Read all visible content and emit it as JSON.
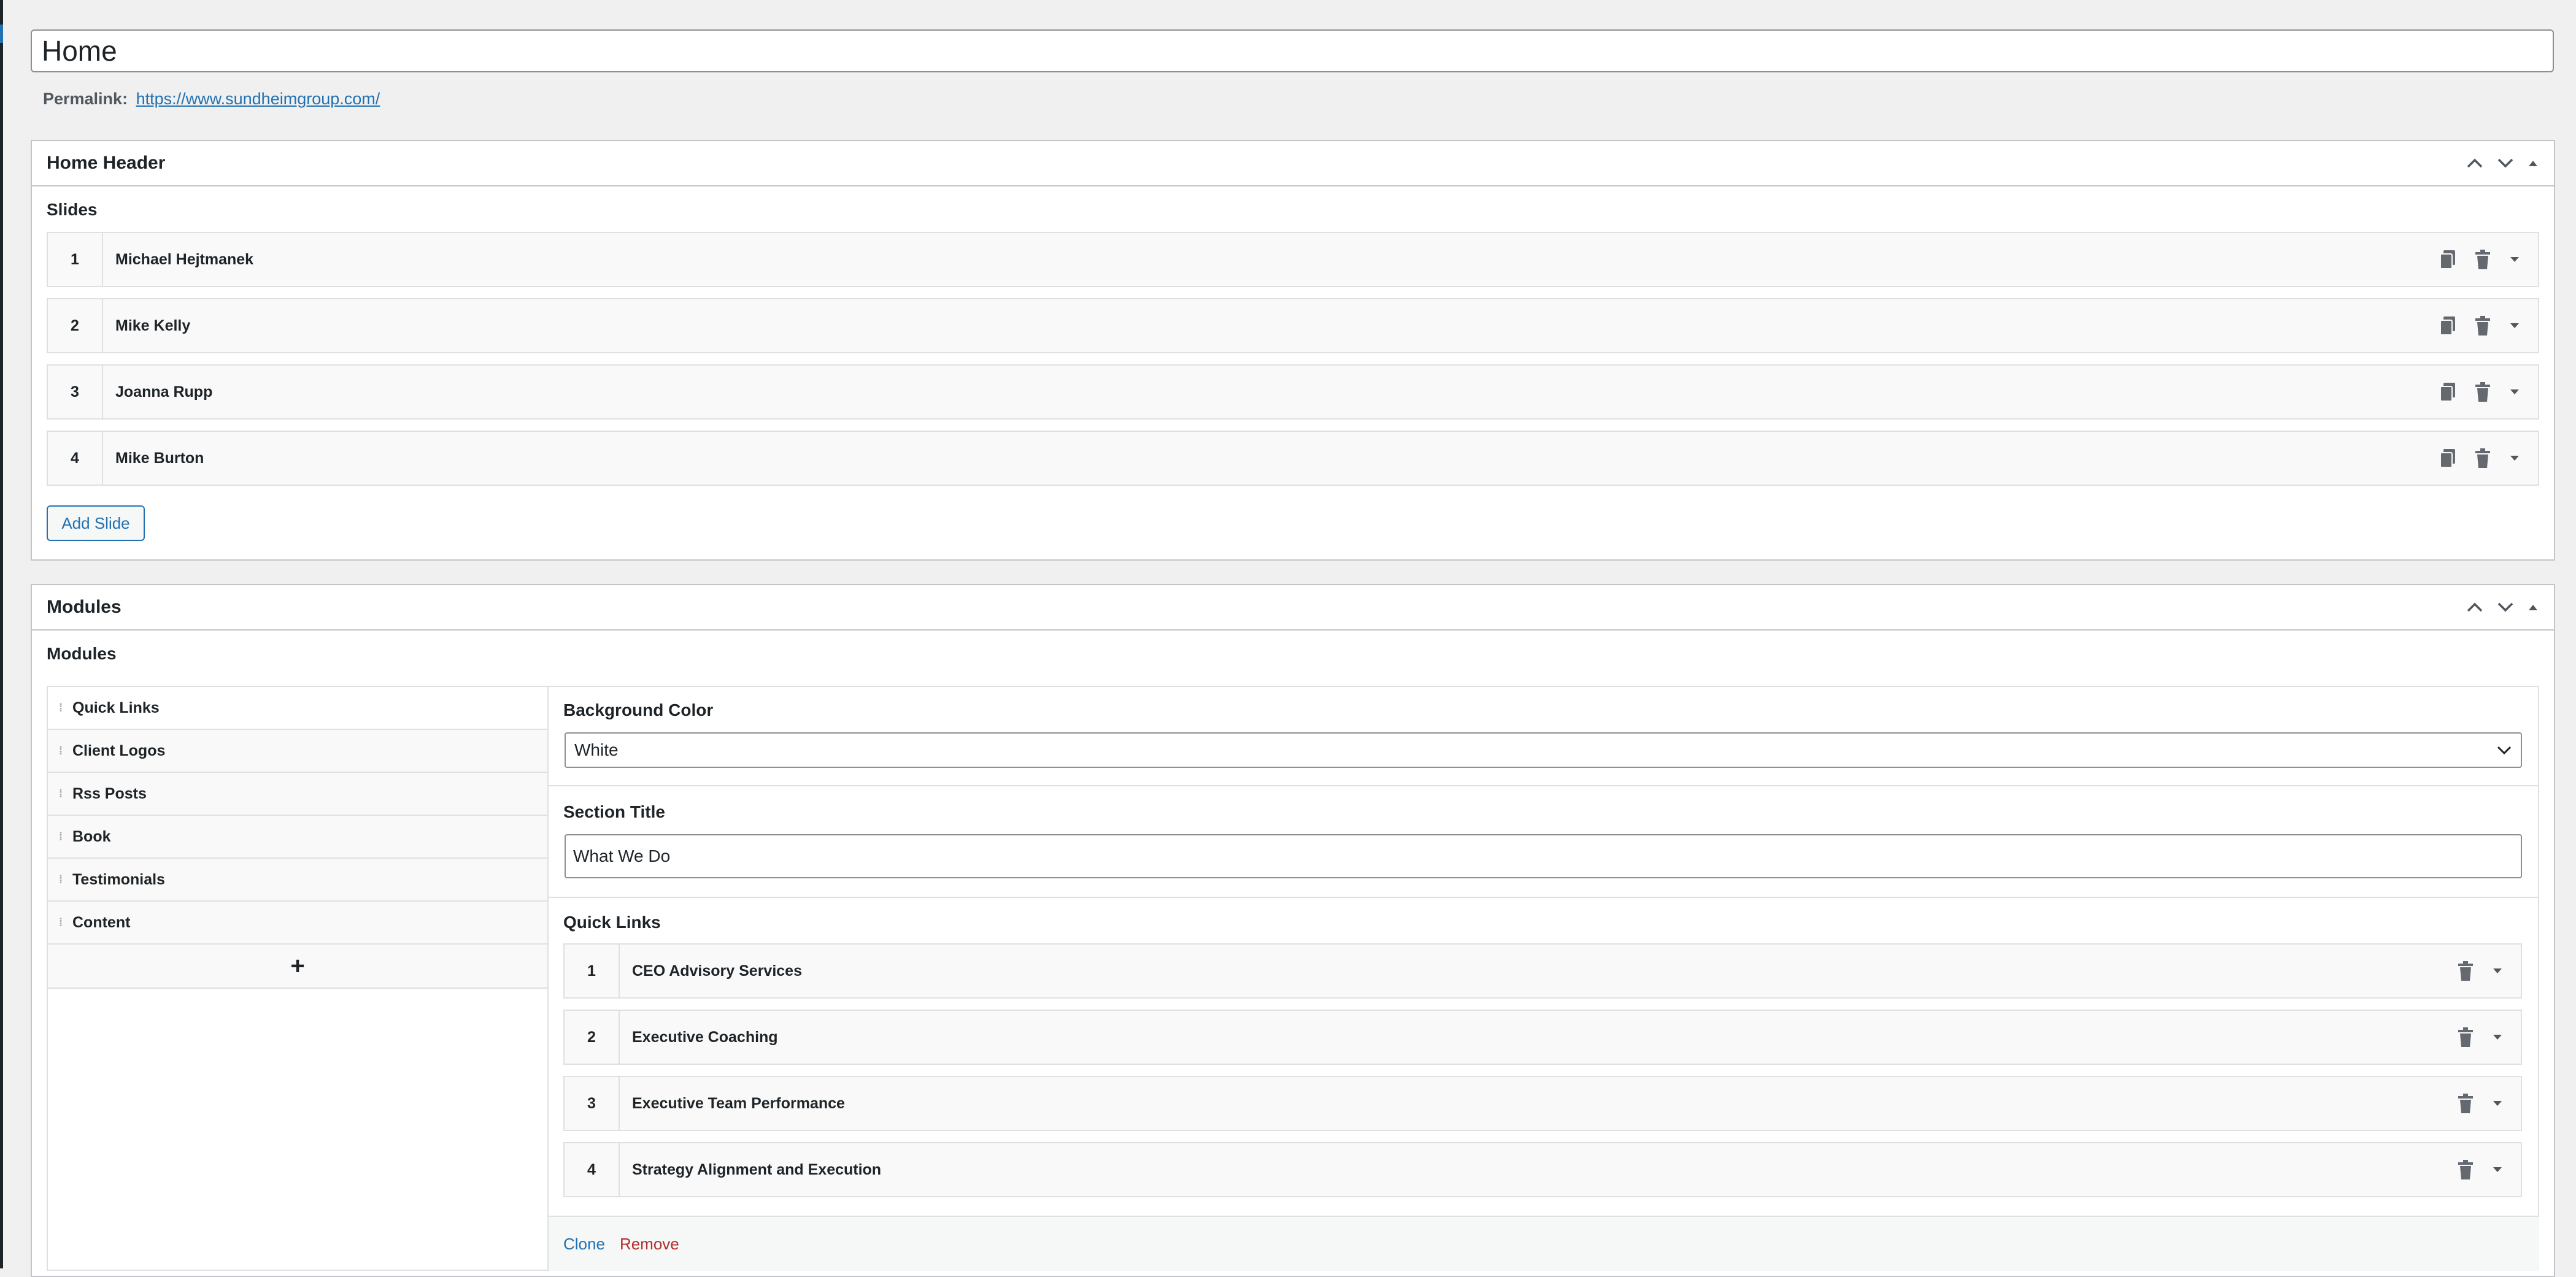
{
  "title": "Home",
  "permalink": {
    "label": "Permalink:",
    "url": "https://www.sundheimgroup.com/"
  },
  "home_header": {
    "title": "Home Header",
    "field_label": "Slides",
    "slides": [
      {
        "num": "1",
        "name": "Michael Hejtmanek"
      },
      {
        "num": "2",
        "name": "Mike Kelly"
      },
      {
        "num": "3",
        "name": "Joanna Rupp"
      },
      {
        "num": "4",
        "name": "Mike Burton"
      }
    ],
    "add_button": "Add Slide"
  },
  "modules": {
    "title": "Modules",
    "field_label": "Modules",
    "layouts": [
      "Quick Links",
      "Client Logos",
      "Rss Posts",
      "Book",
      "Testimonials",
      "Content"
    ],
    "add_symbol": "+",
    "background_color": {
      "label": "Background Color",
      "value": "White"
    },
    "section_title": {
      "label": "Section Title",
      "value": "What We Do"
    },
    "quick_links": {
      "label": "Quick Links",
      "items": [
        {
          "num": "1",
          "name": "CEO Advisory Services"
        },
        {
          "num": "2",
          "name": "Executive Coaching"
        },
        {
          "num": "3",
          "name": "Executive Team Performance"
        },
        {
          "num": "4",
          "name": "Strategy Alignment and Execution"
        }
      ]
    },
    "clone_label": "Clone",
    "remove_label": "Remove"
  },
  "icons": {
    "move_up": "chevron-up-icon",
    "move_down": "chevron-down-icon",
    "toggle": "triangle-up-icon",
    "duplicate": "duplicate-icon",
    "delete": "trash-icon",
    "expand": "caret-down-icon",
    "drag": "drag-handle-icon"
  }
}
